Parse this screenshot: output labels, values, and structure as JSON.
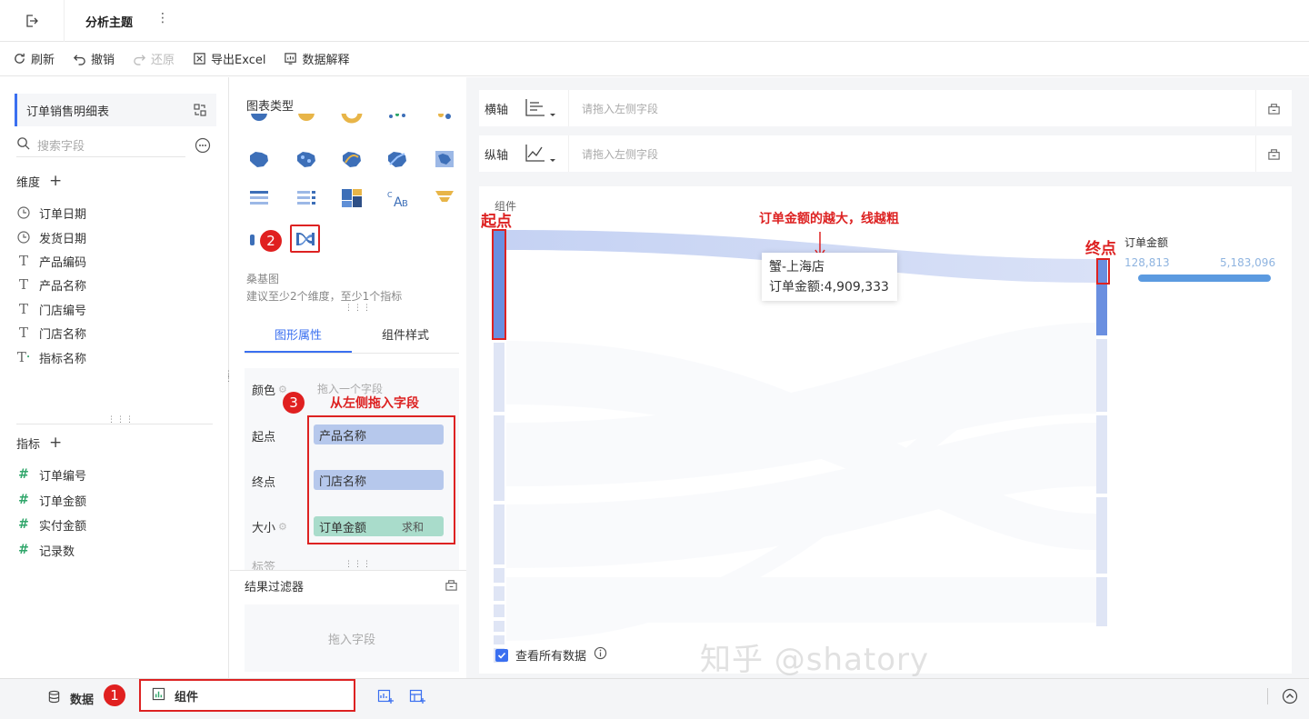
{
  "header": {
    "title": "分析主题"
  },
  "toolbar": {
    "refresh": "刷新",
    "undo": "撤销",
    "redo": "还原",
    "export": "导出Excel",
    "explain": "数据解释"
  },
  "left": {
    "dataset": "订单销售明细表",
    "search_placeholder": "搜索字段",
    "dimensions_title": "维度",
    "dimensions": [
      "订单日期",
      "发货日期",
      "产品编码",
      "产品名称",
      "门店编号",
      "门店名称",
      "指标名称"
    ],
    "measures_title": "指标",
    "measures": [
      "订单编号",
      "订单金额",
      "实付金额",
      "记录数"
    ]
  },
  "middle": {
    "chart_type_title": "图表类型",
    "chart_name": "桑基图",
    "chart_hint": "建议至少2个维度，至少1个指标",
    "tab_props": "图形属性",
    "tab_style": "组件样式",
    "color_label": "颜色",
    "color_placeholder": "拖入一个字段",
    "start_label": "起点",
    "start_value": "产品名称",
    "end_label": "终点",
    "end_value": "门店名称",
    "size_label": "大小",
    "size_value": "订单金额",
    "size_agg": "求和",
    "label_partial": "标签",
    "filter_title": "结果过滤器",
    "filter_placeholder": "拖入字段"
  },
  "annotations": {
    "n1": "1",
    "n2": "2",
    "n3": "3",
    "drag_hint": "从左侧拖入字段",
    "start": "起点",
    "end": "终点",
    "width_note": "订单金额的越大，线越粗"
  },
  "axes": {
    "x_label": "横轴",
    "x_placeholder": "请拖入左侧字段",
    "y_label": "纵轴",
    "y_placeholder": "请拖入左侧字段"
  },
  "chart": {
    "component_label": "组件",
    "tooltip_name": "蟹-上海店",
    "tooltip_value": "订单金额:4,909,333",
    "legend_title": "订单金额",
    "legend_min": "128,813",
    "legend_max": "5,183,096",
    "view_all": "查看所有数据"
  },
  "chart_data": {
    "type": "sankey",
    "source_field": "产品名称",
    "target_field": "门店名称",
    "value_field": "订单金额",
    "highlighted_link": {
      "source": "蟹",
      "target": "上海店",
      "value": 4909333
    },
    "color_range": [
      128813,
      5183096
    ]
  },
  "bottom": {
    "data_tab": "数据",
    "component_tab": "组件"
  },
  "watermark": "知乎 @shatory",
  "colors": {
    "accent": "#3a6ff0",
    "annotation": "#d22222",
    "pill_blue": "#b6c8ec",
    "pill_green": "#a9dccb"
  }
}
